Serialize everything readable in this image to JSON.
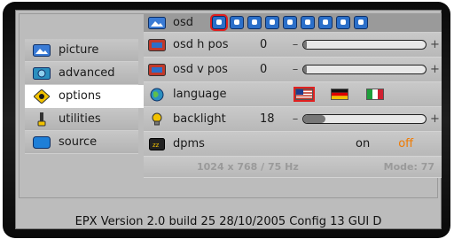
{
  "nav": {
    "items": [
      {
        "label": "picture",
        "icon": "picture-icon"
      },
      {
        "label": "advanced",
        "icon": "advanced-icon"
      },
      {
        "label": "options",
        "icon": "options-icon",
        "active": true
      },
      {
        "label": "utilities",
        "icon": "utilities-icon"
      },
      {
        "label": "source",
        "icon": "source-icon"
      }
    ]
  },
  "settings": {
    "osd": {
      "label": "osd",
      "count": 9,
      "selected_index": 0
    },
    "osd_h_pos": {
      "label": "osd h pos",
      "value": "0",
      "minus": "–",
      "plus": "+",
      "level": 0.03
    },
    "osd_v_pos": {
      "label": "osd v pos",
      "value": "0",
      "minus": "–",
      "plus": "+",
      "level": 0.03
    },
    "language": {
      "label": "language",
      "options": [
        "US",
        "DE",
        "IT"
      ]
    },
    "backlight": {
      "label": "backlight",
      "value": "18",
      "minus": "–",
      "plus": "+",
      "level": 0.18
    },
    "dpms": {
      "label": "dpms",
      "on": "on",
      "off": "off"
    },
    "resolution": {
      "text": "1024 x 768 / 75 Hz",
      "mode": "Mode: 77"
    }
  },
  "footer": {
    "text": "EPX Version 2.0 build 25   28/10/2005  Config 13   GUI D"
  },
  "colors": {
    "accent_off": "#f07a00",
    "selected_ring": "#e02020",
    "icon_blue": "#2b6fc9"
  }
}
